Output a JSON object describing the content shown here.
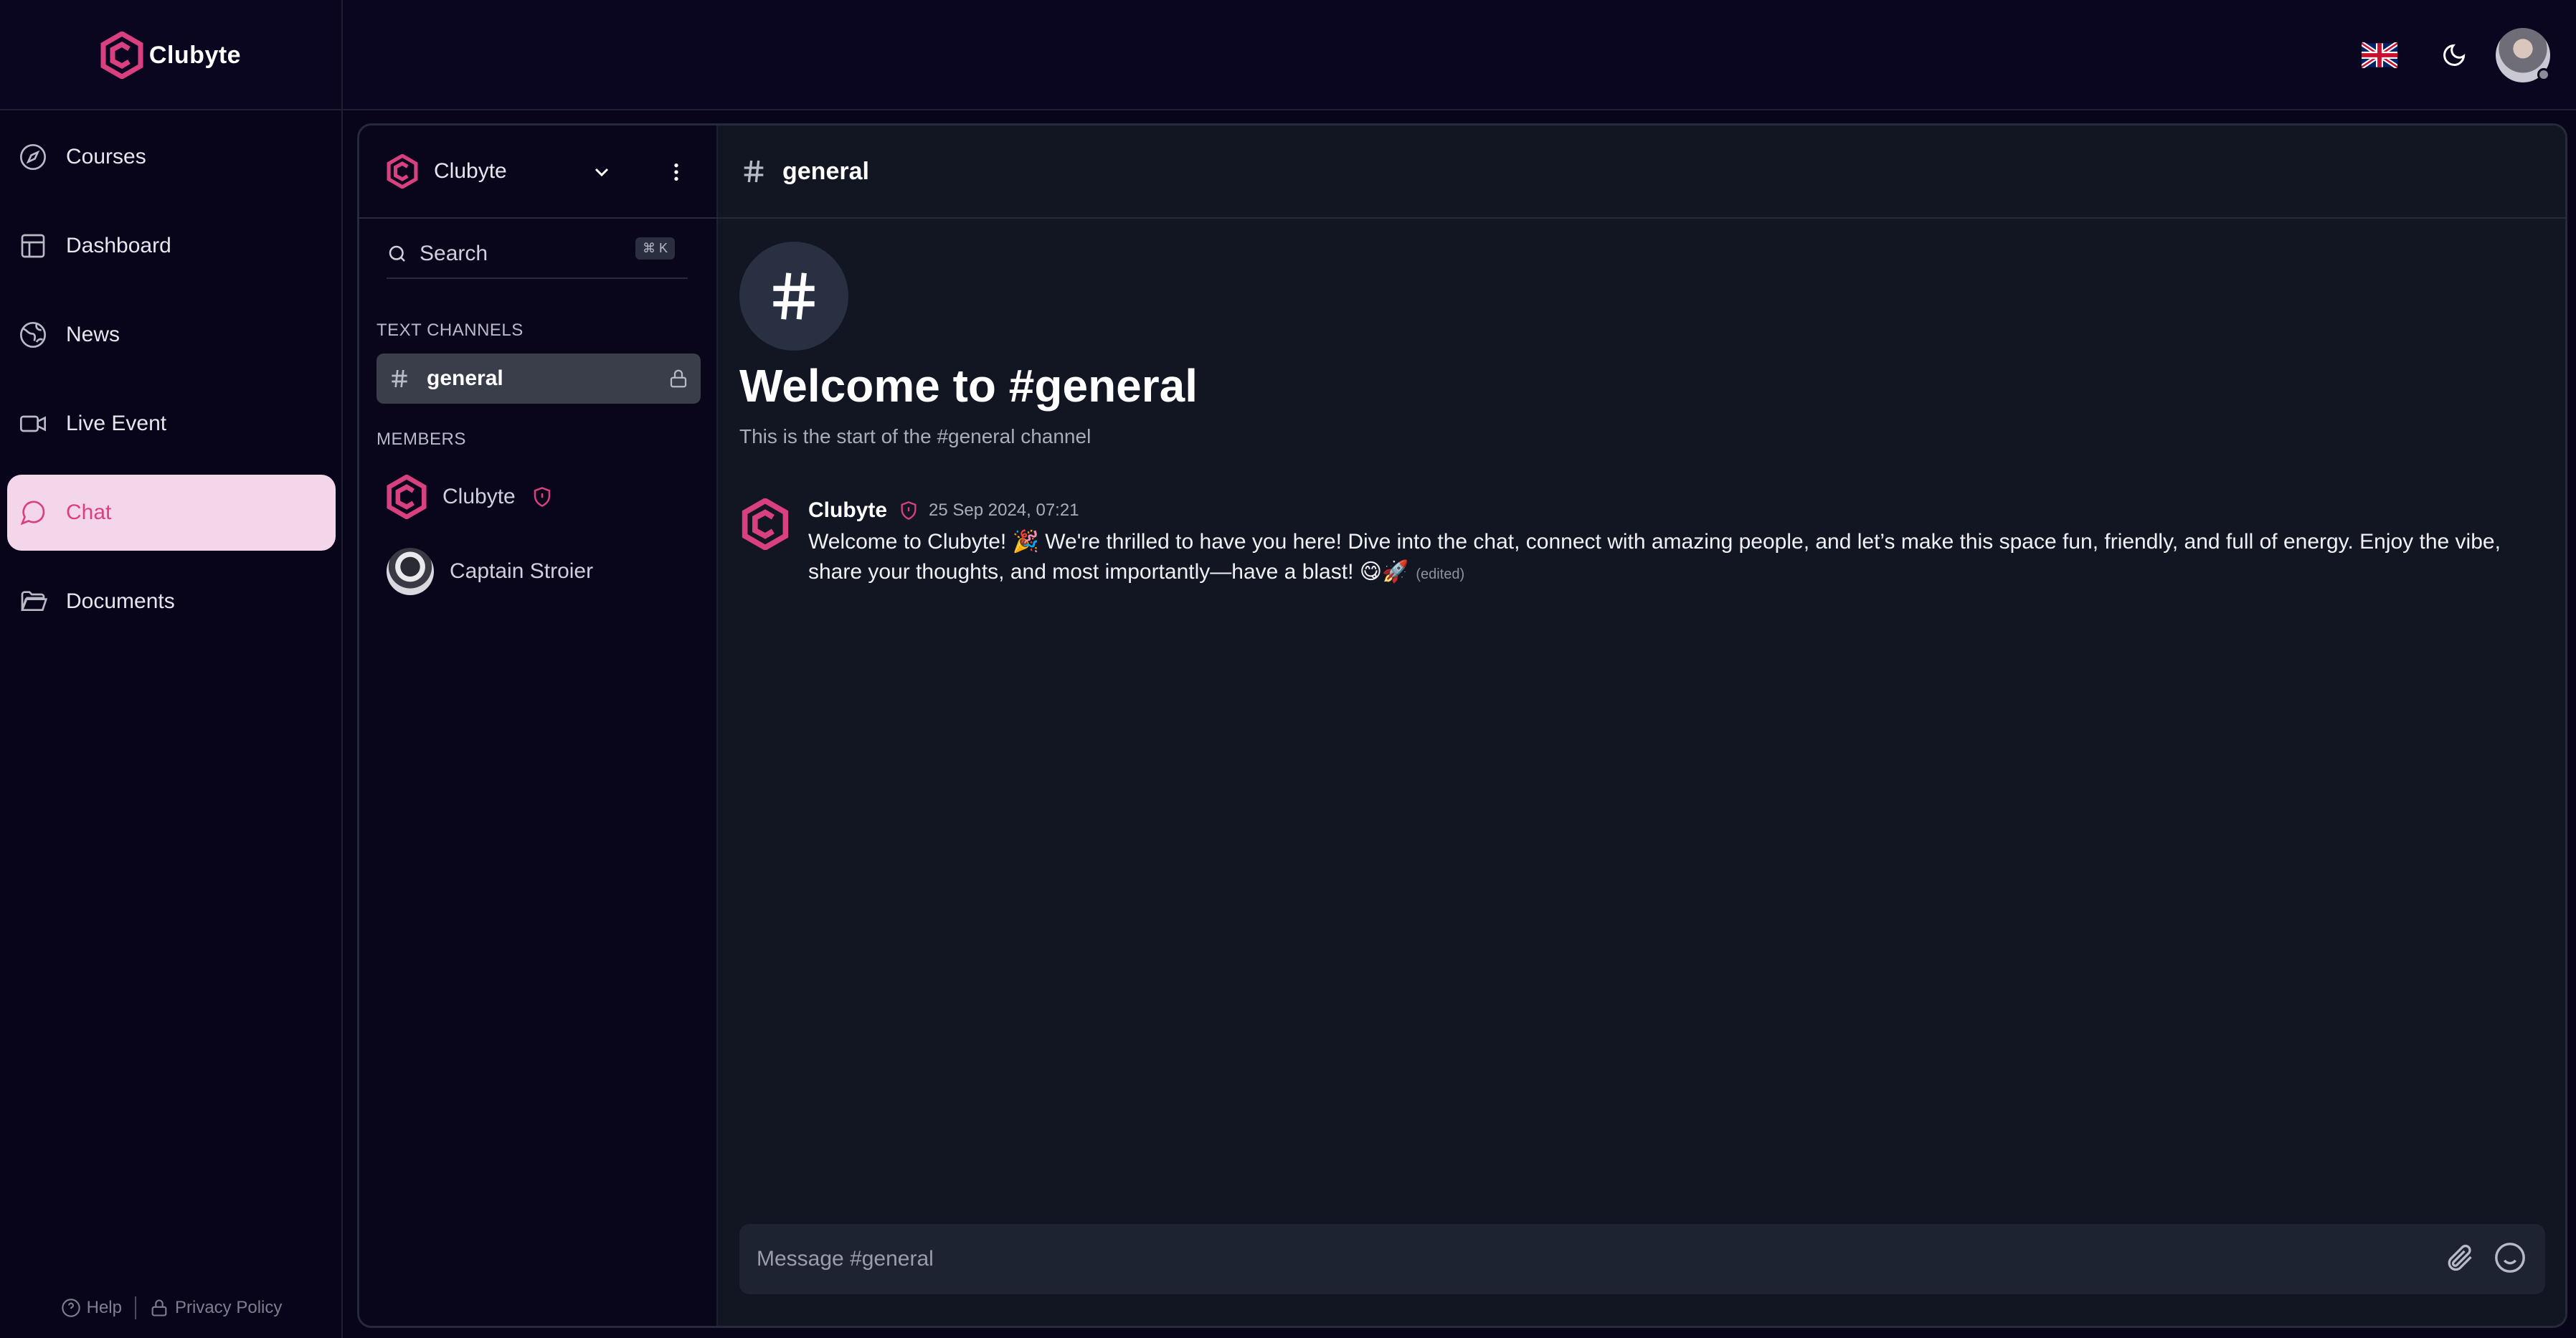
{
  "app": {
    "name": "Clubyte"
  },
  "colors": {
    "accent": "#d9407f",
    "bg": "#08051a",
    "panel": "#121622",
    "active_nav_bg": "#f3d6ea"
  },
  "sidebar": {
    "items": [
      {
        "label": "Courses",
        "icon": "compass-icon"
      },
      {
        "label": "Dashboard",
        "icon": "layout-icon"
      },
      {
        "label": "News",
        "icon": "globe-icon"
      },
      {
        "label": "Live Event",
        "icon": "video-icon"
      },
      {
        "label": "Chat",
        "icon": "message-circle-icon",
        "active": true
      },
      {
        "label": "Documents",
        "icon": "folder-icon"
      }
    ],
    "footer": {
      "help": "Help",
      "privacy": "Privacy Policy"
    }
  },
  "channels_panel": {
    "server_name": "Clubyte",
    "search_label": "Search",
    "search_shortcut": "⌘ K",
    "text_channels_title": "TEXT CHANNELS",
    "channels": [
      {
        "name": "general",
        "locked": true
      }
    ],
    "members_title": "MEMBERS",
    "members": [
      {
        "name": "Clubyte",
        "badge": "shield-icon"
      },
      {
        "name": "Captain Stroier"
      }
    ]
  },
  "chat": {
    "channel_name": "general",
    "welcome_title": "Welcome to #general",
    "welcome_subtitle": "This is the start of the #general channel",
    "messages": [
      {
        "author": "Clubyte",
        "timestamp": "25 Sep 2024, 07:21",
        "text": "Welcome to Clubyte! 🎉 We're thrilled to have you here! Dive into the chat, connect with amazing people, and let’s make this space fun, friendly, and full of energy. Enjoy the vibe, share your thoughts, and most importantly—have a blast! 😋🚀",
        "edited": "(edited)"
      }
    ],
    "composer_placeholder": "Message #general"
  }
}
